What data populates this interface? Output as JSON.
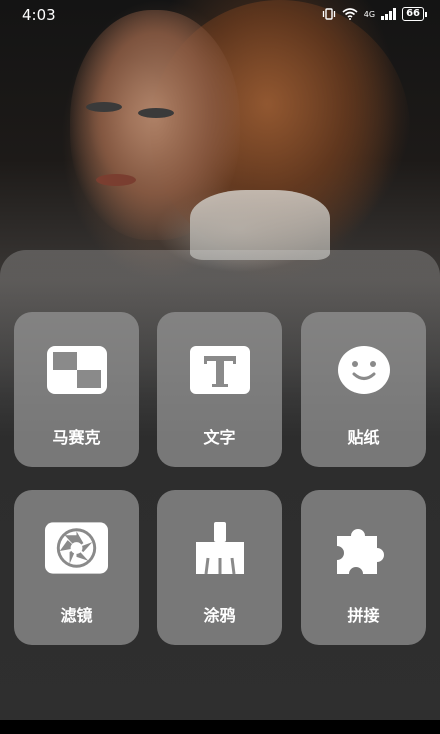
{
  "status_bar": {
    "time": "4:03",
    "network": "4G",
    "battery": "66"
  },
  "tools": [
    {
      "label": "马赛克",
      "icon": "mosaic-icon"
    },
    {
      "label": "文字",
      "icon": "text-icon"
    },
    {
      "label": "贴纸",
      "icon": "sticker-icon"
    },
    {
      "label": "滤镜",
      "icon": "filter-icon"
    },
    {
      "label": "涂鸦",
      "icon": "brush-icon"
    },
    {
      "label": "拼接",
      "icon": "puzzle-icon"
    }
  ],
  "colors": {
    "tile_bg": "#969696",
    "icon": "#ffffff"
  }
}
